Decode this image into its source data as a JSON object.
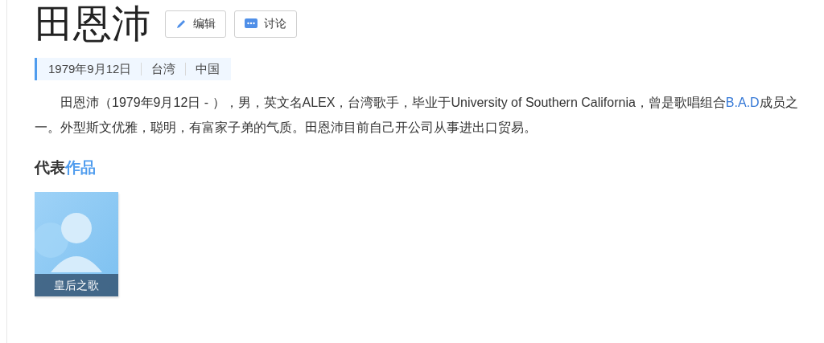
{
  "title": "田恩沛",
  "actions": [
    {
      "kind": "edit",
      "label": "编辑"
    },
    {
      "kind": "discuss",
      "label": "讨论"
    }
  ],
  "info": [
    "1979年9月12日",
    "台湾",
    "中国"
  ],
  "summary": [
    {
      "kind": "plain",
      "text": "田恩沛（1979年9月12日 - ），男，英文名ALEX，台湾歌手，毕业于University of Southern California，曾是歌唱组合"
    },
    {
      "kind": "link",
      "text": "B.A.D"
    },
    {
      "kind": "plain",
      "text": "成员之一。外型斯文优雅，聪明，有富家子弟的气质。田恩沛目前自己开公司从事进出口贸易。"
    }
  ],
  "section": {
    "title": "代表",
    "highlight": "作品"
  },
  "works": [
    {
      "kind": "picture",
      "caption": "皇后之歌"
    }
  ]
}
